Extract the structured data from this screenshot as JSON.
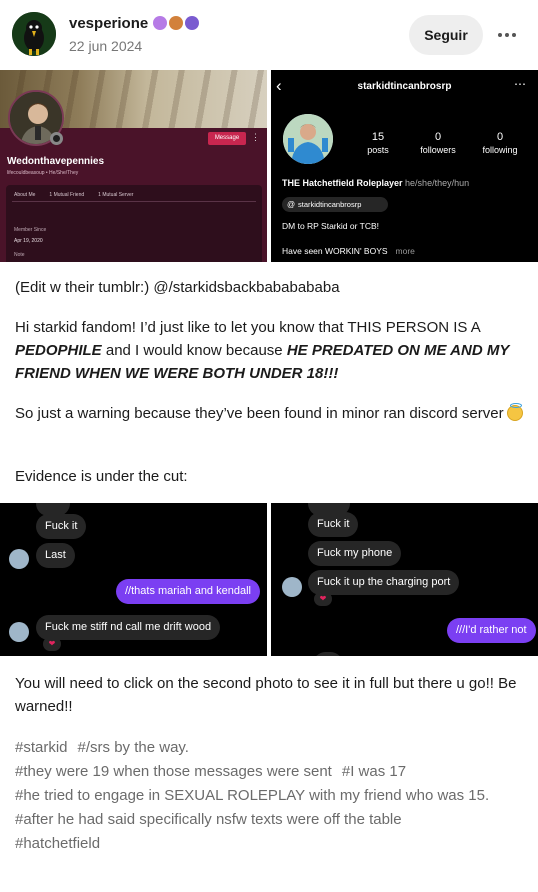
{
  "header": {
    "username": "vesperione",
    "date": "22 jun 2024",
    "follow_label": "Seguir",
    "badge_colors": [
      "#b67be6",
      "#d2813b",
      "#7a5bd0"
    ]
  },
  "image_left": {
    "message_label": "Message",
    "profile_name": "Wedonthavepennies",
    "profile_sub": "lifecouldbeasoup • He/She/They",
    "tabs": [
      "About Me",
      "1 Mutual Friend",
      "1 Mutual Server"
    ],
    "member_since_label": "Member Since",
    "member_since_value": "Apr 19, 2020",
    "note_label": "Note"
  },
  "image_right": {
    "username": "starkidtincanbrosrp",
    "stats": [
      {
        "number": "15",
        "label": "posts"
      },
      {
        "number": "0",
        "label": "followers"
      },
      {
        "number": "0",
        "label": "following"
      }
    ],
    "display_name": "THE Hatchetfield Roleplayer",
    "pronouns": "he/she/they/hun",
    "threads_handle": "starkidtincanbrosrp",
    "bio_line1": "DM to RP Starkid or TCB!",
    "bio_line2": "Have seen WORKIN' BOYS",
    "more_label": "more"
  },
  "post": {
    "edit_line": "(Edit w their tumblr:) @/starkidsbackbababababa",
    "para1_a": "Hi starkid fandom! I’d just like to let you know that THIS PERSON IS A ",
    "para1_b": "PEDOPHILE",
    "para1_c": " and I would know because ",
    "para1_d": "HE PREDATED ON ME AND MY FRIEND WHEN WE WERE BOTH UNDER 18!!!",
    "para2": "So just a warning because they’ve been found in minor ran discord server",
    "para3": "Evidence is under the cut:",
    "para4": "You will need to click on the second photo to see it in full but there u go!! Be warned!!"
  },
  "chat_left": {
    "messages": [
      "Fuck it",
      "Last",
      "//thats mariah and kendall",
      "Fuck me stiff nd call me drift wood"
    ]
  },
  "chat_right": {
    "messages": [
      "Fuck it",
      "Fuck my phone",
      "Fuck it up the charging port",
      "///I'd rather not"
    ]
  },
  "tags": [
    "#starkid",
    "#/srs by the way.",
    "#they were 19 when those messages were sent",
    "#I was 17",
    "#he tried to engage in SEXUAL ROLEPLAY with my friend who was 15.",
    "#after he had said specifically nsfw texts were off the table",
    "#hatchetfield"
  ]
}
